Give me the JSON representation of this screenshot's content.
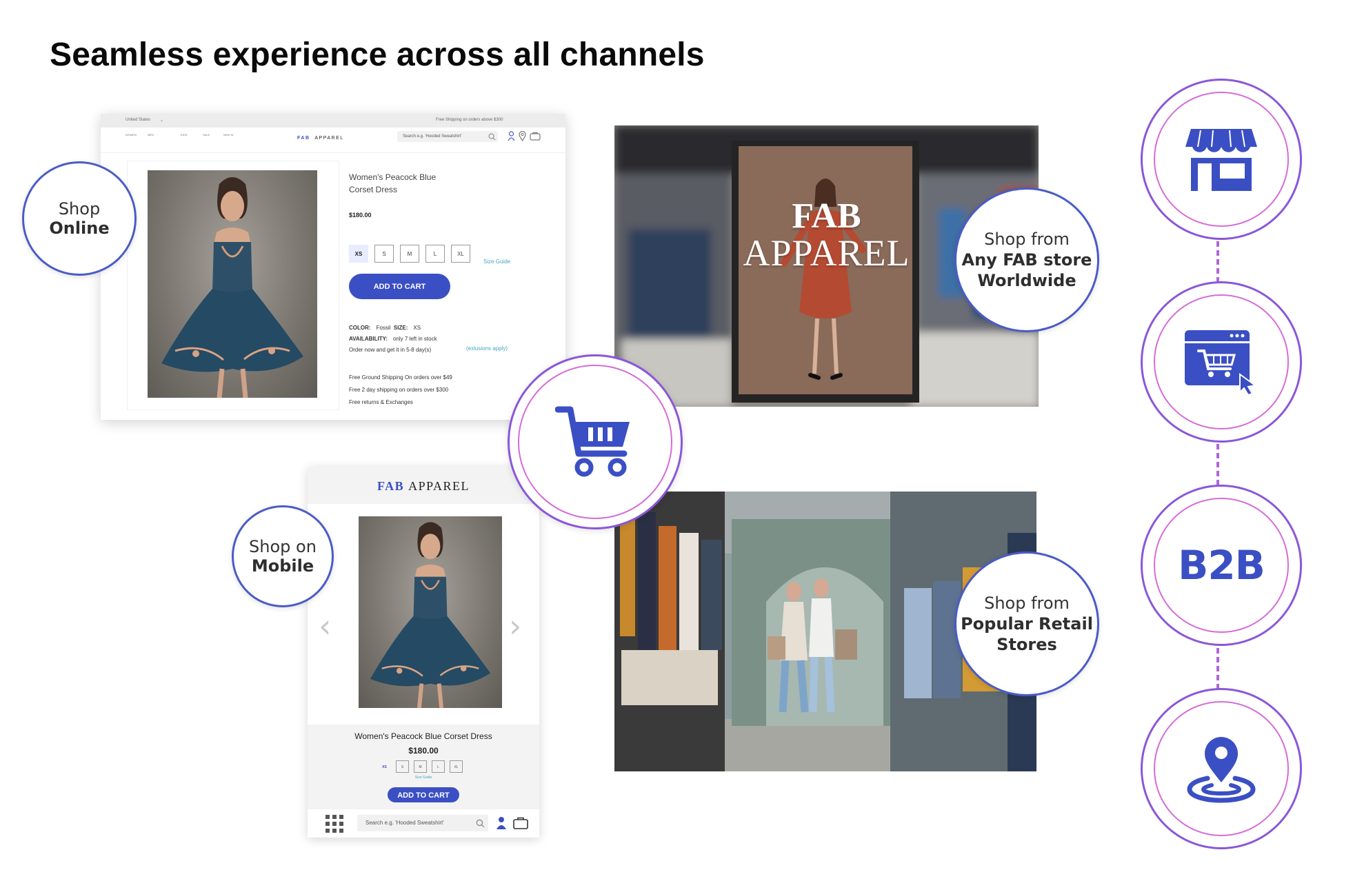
{
  "page": {
    "title": "Seamless experience across all channels"
  },
  "colors": {
    "brand_blue": "#3b4fc4",
    "ring_purple": "#8a57d9",
    "ring_pink": "#d56cd6",
    "link_teal": "#47a3c2"
  },
  "desktop": {
    "region": "United States",
    "free_shipping_banner": "Free Shipping on orders above $300",
    "nav_links": [
      "WOMEN",
      "MEN",
      "KIDS",
      "SALE",
      "NEW IN"
    ],
    "logo_fab": "FAB",
    "logo_apparel": "APPAREL",
    "search_placeholder": "Search e.g. 'Hooded Sweatshirt'",
    "icons": [
      "user-icon",
      "location-pin-icon",
      "bag-icon"
    ],
    "product": {
      "name_line1": "Women's Peacock Blue",
      "name_line2": "Corset Dress",
      "price": "$180.00",
      "sizes": [
        "XS",
        "S",
        "M",
        "L",
        "XL"
      ],
      "selected_size": "XS",
      "size_guide": "Size Guide",
      "add_to_cart": "ADD TO CART",
      "color_label": "COLOR:",
      "color_value": "Fossil",
      "size_label": "SIZE:",
      "size_value": "XS",
      "availability_label": "AVAILABILITY:",
      "availability_value": "only 7 left in stock",
      "delivery": "Order now and get it in 5-8 day(s)",
      "exclusions": "(exlusions apply)",
      "shipping": [
        "Free Ground Shipping On orders over $49",
        "Free 2 day shipping on orders over $300",
        "Free returns & Exchanges"
      ]
    }
  },
  "mobile": {
    "logo_fab": "FAB",
    "logo_apparel": "APPAREL",
    "product_name": "Women's Peacock Blue Corset Dress",
    "price": "$180.00",
    "sizes": [
      "XS",
      "S",
      "M",
      "L",
      "XL"
    ],
    "size_guide": "Size Guide",
    "add_to_cart": "ADD TO CART",
    "search_placeholder": "Search e.g. 'Hooded Sweatshirt'",
    "icons": [
      "grid-icon",
      "user-icon",
      "bag-icon",
      "chevron-left-icon",
      "chevron-right-icon"
    ]
  },
  "store_poster": {
    "line1": "FAB",
    "line2": "APPAREL"
  },
  "labels": {
    "online": {
      "line1": "Shop",
      "line2": "Online"
    },
    "mobile": {
      "line1": "Shop on",
      "line2": "Mobile"
    },
    "fab_store": {
      "line1": "Shop from",
      "line2": "Any FAB store",
      "line3": "Worldwide"
    },
    "retail": {
      "line1": "Shop from",
      "line2": "Popular Retail",
      "line3": "Stores"
    }
  },
  "channel_icons": [
    "storefront-icon",
    "web-cart-icon",
    "b2b-text",
    "location-pin-icon"
  ],
  "b2b_text": "B2B",
  "center_icon": "shopping-cart-icon"
}
